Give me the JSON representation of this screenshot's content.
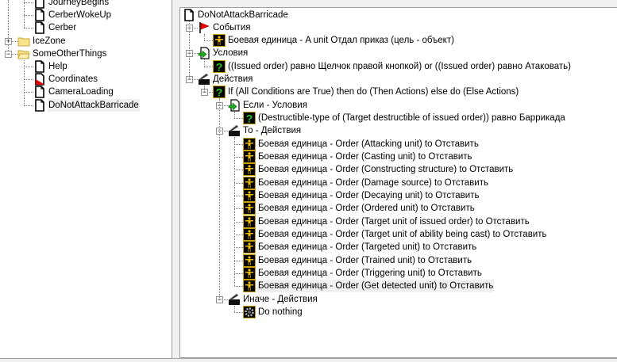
{
  "left_tree": {
    "items": [
      {
        "label": "JourneyBegins",
        "icon": "doc"
      },
      {
        "label": "CerberWokeUp",
        "icon": "doc"
      },
      {
        "label": "Cerber",
        "icon": "doc"
      },
      {
        "label": "IceZone",
        "icon": "folder",
        "expander": "+"
      },
      {
        "label": "SomeOtherThings",
        "icon": "folder-open",
        "expander": "−"
      },
      {
        "label": "Help",
        "icon": "doc"
      },
      {
        "label": "Coordinates",
        "icon": "doc-red"
      },
      {
        "label": "CameraLoading",
        "icon": "doc"
      },
      {
        "label": "DoNotAttackBarricade",
        "icon": "doc",
        "selected": true
      }
    ]
  },
  "right_tree": {
    "root": {
      "label": "DoNotAttackBarricade",
      "icon": "doc",
      "children": [
        {
          "label": "События",
          "icon": "flag",
          "children": [
            {
              "label": "Боевая единица - A unit Отдал приказ (цель - объект)",
              "icon": "unit"
            }
          ]
        },
        {
          "label": "Условия",
          "icon": "cond",
          "children": [
            {
              "label": "((Issued order) равно Щелчок правой кнопкой) or ((Issued order) равно Атаковать)",
              "icon": "question"
            }
          ]
        },
        {
          "label": "Действия",
          "icon": "clapper",
          "children": [
            {
              "label": "If (All Conditions are True) then do (Then Actions) else do (Else Actions)",
              "icon": "question",
              "children": [
                {
                  "label": "Если - Условия",
                  "icon": "cond",
                  "children": [
                    {
                      "label": "(Destructible-type of (Target destructible of issued order)) равно Баррикада",
                      "icon": "question"
                    }
                  ]
                },
                {
                  "label": "То - Действия",
                  "icon": "clapper",
                  "children": [
                    {
                      "label": "Боевая единица - Order (Attacking unit) to Отставить",
                      "icon": "unit"
                    },
                    {
                      "label": "Боевая единица - Order (Casting unit) to Отставить",
                      "icon": "unit"
                    },
                    {
                      "label": "Боевая единица - Order (Constructing structure) to Отставить",
                      "icon": "unit"
                    },
                    {
                      "label": "Боевая единица - Order (Damage source) to Отставить",
                      "icon": "unit"
                    },
                    {
                      "label": "Боевая единица - Order (Decaying unit) to Отставить",
                      "icon": "unit"
                    },
                    {
                      "label": "Боевая единица - Order (Ordered unit) to Отставить",
                      "icon": "unit"
                    },
                    {
                      "label": "Боевая единица - Order (Target unit of issued order) to Отставить",
                      "icon": "unit"
                    },
                    {
                      "label": "Боевая единица - Order (Target unit of ability being cast) to Отставить",
                      "icon": "unit"
                    },
                    {
                      "label": "Боевая единица - Order (Targeted unit) to Отставить",
                      "icon": "unit"
                    },
                    {
                      "label": "Боевая единица - Order (Trained unit) to Отставить",
                      "icon": "unit"
                    },
                    {
                      "label": "Боевая единица - Order (Triggering unit) to Отставить",
                      "icon": "unit"
                    },
                    {
                      "label": "Боевая единица - Order (Get detected unit) to Отставить",
                      "icon": "unit",
                      "selected": true
                    }
                  ]
                },
                {
                  "label": "Иначе - Действия",
                  "icon": "clapper",
                  "children": [
                    {
                      "label": "Do nothing",
                      "icon": "gear"
                    }
                  ]
                }
              ]
            }
          ]
        }
      ]
    }
  }
}
